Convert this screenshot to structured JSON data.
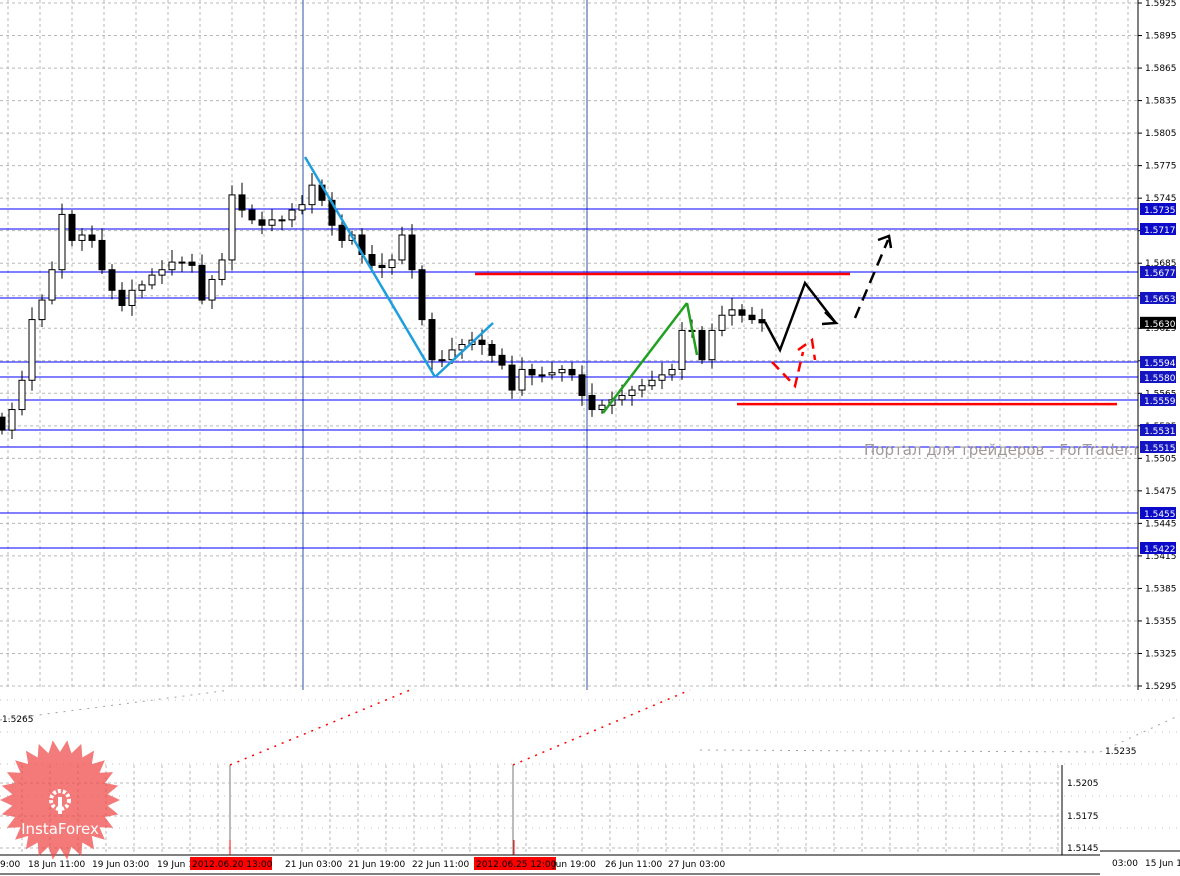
{
  "chart_data": {
    "type": "candlestick",
    "instrument_timeframe": "H1",
    "y_range": [
      1.5295,
      1.5925
    ],
    "y_ticks": [
      "1.5925",
      "1.5895",
      "1.5865",
      "1.5835",
      "1.5805",
      "1.5775",
      "1.5745",
      "1.5715",
      "1.5685",
      "1.5655",
      "1.5625",
      "1.5595",
      "1.5565",
      "1.5535",
      "1.5505",
      "1.5475",
      "1.5445",
      "1.5415",
      "1.5385",
      "1.5355",
      "1.5325",
      "1.5295"
    ],
    "x_labels": [
      {
        "text": "9:00",
        "highlight": false
      },
      {
        "text": "18 Jun 11:00",
        "highlight": false
      },
      {
        "text": "19 Jun 03:00",
        "highlight": false
      },
      {
        "text": "19 Jun 1",
        "highlight": false
      },
      {
        "text": "2012.06.20 13:00",
        "highlight": true
      },
      {
        "text": "21 Jun 03:00",
        "highlight": false
      },
      {
        "text": "21 Jun 19:00",
        "highlight": false
      },
      {
        "text": "22 Jun 11:00",
        "highlight": false
      },
      {
        "text": "2012.06.25 12:00",
        "highlight": true
      },
      {
        "text": "Jun 19:00",
        "highlight": false
      },
      {
        "text": "26 Jun 11:00",
        "highlight": false
      },
      {
        "text": "27 Jun 03:00",
        "highlight": false
      }
    ],
    "closes": [
      1.5531,
      1.555,
      1.5577,
      1.5633,
      1.5651,
      1.5679,
      1.573,
      1.5706,
      1.5711,
      1.5706,
      1.5679,
      1.566,
      1.5646,
      1.566,
      1.5665,
      1.5674,
      1.5679,
      1.5686,
      1.5686,
      1.5683,
      1.5651,
      1.567,
      1.5688,
      1.5748,
      1.5734,
      1.5725,
      1.572,
      1.5725,
      1.5725,
      1.5734,
      1.5739,
      1.5757,
      1.5743,
      1.572,
      1.5706,
      1.5711,
      1.5693,
      1.5683,
      1.5681,
      1.5688,
      1.5711,
      1.5679,
      1.5633,
      1.5596,
      1.5596,
      1.5605,
      1.561,
      1.5614,
      1.561,
      1.56,
      1.5591,
      1.5568,
      1.5587,
      1.5582,
      1.5582,
      1.5584,
      1.5587,
      1.5582,
      1.5563,
      1.555,
      1.5554,
      1.5559,
      1.5563,
      1.5568,
      1.5572,
      1.5577,
      1.5582,
      1.5587,
      1.5623,
      1.5623,
      1.5596,
      1.5623,
      1.5637,
      1.5642,
      1.5637,
      1.5633,
      1.563
    ],
    "current_price": "1.5630",
    "levels": [
      "1.5735",
      "1.5717",
      "1.5677",
      "1.5653",
      "1.5594",
      "1.5580",
      "1.5559",
      "1.5531",
      "1.5515",
      "1.5455",
      "1.5422"
    ],
    "red_levels": [
      1.5675,
      1.5555
    ],
    "lower_panel": {
      "y_ticks": [
        "1.5265",
        "1.5235",
        "1.5205",
        "1.5175",
        "1.5145"
      ],
      "x_labels": [
        "03:00",
        "15 Jun 1"
      ]
    },
    "colors": {
      "level": "#0000ff",
      "level_label": "#0000c8",
      "red_line": "#ff0000",
      "trend_blue": "#1e9fdc",
      "trend_green": "#22a022",
      "forecast": "#000000",
      "grid": "#b8b8b8"
    }
  },
  "watermark": "Портал для трейдеров - ForTrader.ru",
  "logo": {
    "text": "InstaForex"
  }
}
